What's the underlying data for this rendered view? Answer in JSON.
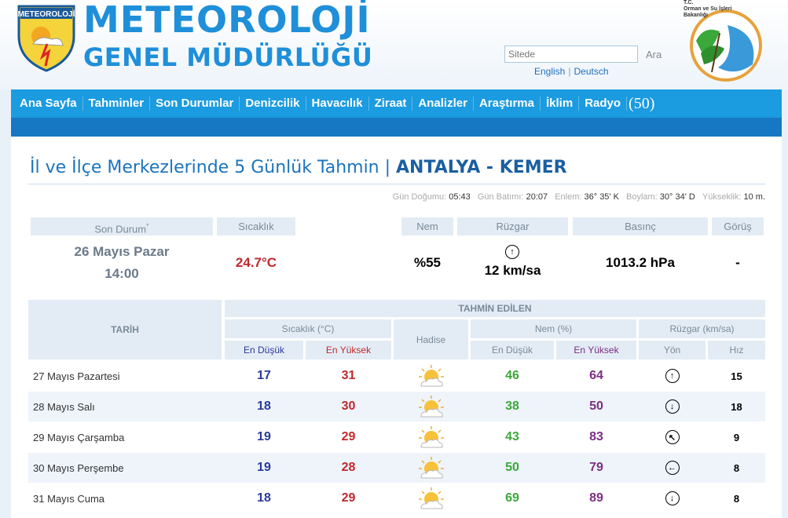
{
  "header": {
    "logo_text": "METEOROLOJİ",
    "title_line1": "METEOROLOJİ",
    "title_line2": "GENEL MÜDÜRLÜĞÜ",
    "search_placeholder": "Sitede",
    "search_button": "Ara",
    "lang_english": "English",
    "lang_deutsch": "Deutsch",
    "ministry_line1": "T.C.",
    "ministry_line2": "Orman ve Su İşleri",
    "ministry_line3": "Bakanlığı"
  },
  "nav": {
    "items": [
      "Ana Sayfa",
      "Tahminler",
      "Son Durumlar",
      "Denizcilik",
      "Havacılık",
      "Ziraat",
      "Analizler",
      "Araştırma",
      "İklim",
      "Radyo"
    ],
    "radio_badge": "(50)"
  },
  "page": {
    "title_prefix": "İl ve İlçe Merkezlerinde 5 Günlük Tahmin | ",
    "title_location": "ANTALYA - KEMER"
  },
  "sun_info": {
    "sunrise_label": "Gün Doğumu:",
    "sunrise": "05:43",
    "sunset_label": "Gün Batımı:",
    "sunset": "20:07",
    "lat_label": "Enlem:",
    "lat": "36° 35' K",
    "lon_label": "Boylam:",
    "lon": "30° 34' D",
    "alt_label": "Yükseklik:",
    "alt": "10 m."
  },
  "current": {
    "labels": {
      "status": "Son Durum",
      "status_mark": "*",
      "temp": "Sıcaklık",
      "humidity": "Nem",
      "wind": "Rüzgar",
      "pressure": "Basınç",
      "visibility": "Görüş"
    },
    "date": "26 Mayıs Pazar",
    "time": "14:00",
    "temp": "24.7°C",
    "humidity": "%55",
    "wind_speed": "12 km/sa",
    "wind_arrow": "↑",
    "pressure": "1013.2 hPa",
    "visibility": "-"
  },
  "forecast": {
    "headers": {
      "date": "TARİH",
      "forecasted": "TAHMİN EDİLEN",
      "temp_group": "Sıcaklık (°C)",
      "event": "Hadise",
      "humidity_group": "Nem (%)",
      "wind_group": "Rüzgar (km/sa)",
      "min": "En Düşük",
      "max": "En Yüksek",
      "hum_min": "En Düşük",
      "hum_max": "En Yüksek",
      "dir": "Yön",
      "speed": "Hız"
    },
    "rows": [
      {
        "date": "27 Mayıs Pazartesi",
        "tmin": "17",
        "tmax": "31",
        "icon": "partly-cloudy-icon",
        "hmin": "46",
        "hmax": "64",
        "dir": "↑",
        "speed": "15"
      },
      {
        "date": "28 Mayıs Salı",
        "tmin": "18",
        "tmax": "30",
        "icon": "partly-cloudy-icon",
        "hmin": "38",
        "hmax": "50",
        "dir": "↓",
        "speed": "18"
      },
      {
        "date": "29 Mayıs Çarşamba",
        "tmin": "19",
        "tmax": "29",
        "icon": "partly-cloudy-icon",
        "hmin": "43",
        "hmax": "83",
        "dir": "↖",
        "speed": "9"
      },
      {
        "date": "30 Mayıs Perşembe",
        "tmin": "19",
        "tmax": "28",
        "icon": "partly-cloudy-icon",
        "hmin": "50",
        "hmax": "79",
        "dir": "←",
        "speed": "8"
      },
      {
        "date": "31 Mayıs Cuma",
        "tmin": "18",
        "tmax": "29",
        "icon": "partly-cloudy-icon",
        "hmin": "69",
        "hmax": "89",
        "dir": "↓",
        "speed": "8"
      }
    ]
  },
  "colors": {
    "brand": "#1f8fd9",
    "nav": "#1b9be0",
    "temp_min": "#2a3a9a",
    "temp_max": "#c0282d",
    "hum_min": "#3aa83a",
    "hum_max": "#7b2e83"
  }
}
